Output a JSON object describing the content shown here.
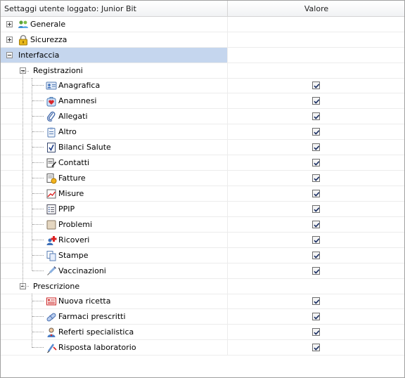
{
  "header": {
    "col_setting": "Settaggi utente loggato: Junior Bit",
    "col_value": "Valore"
  },
  "tree": {
    "generale": "Generale",
    "sicurezza": "Sicurezza",
    "interfaccia": "Interfaccia",
    "registrazioni": "Registrazioni",
    "prescrizione": "Prescrizione"
  },
  "registrazioni_items": [
    {
      "label": "Anagrafica",
      "icon": "contact-card-icon",
      "checked": true
    },
    {
      "label": "Anamnesi",
      "icon": "heart-bag-icon",
      "checked": true
    },
    {
      "label": "Allegati",
      "icon": "paperclip-icon",
      "checked": true
    },
    {
      "label": "Altro",
      "icon": "clipboard-list-icon",
      "checked": true
    },
    {
      "label": "Bilanci Salute",
      "icon": "check-document-icon",
      "checked": true
    },
    {
      "label": "Contatti",
      "icon": "note-pen-icon",
      "checked": true
    },
    {
      "label": "Fatture",
      "icon": "invoice-coin-icon",
      "checked": true
    },
    {
      "label": "Misure",
      "icon": "chart-measure-icon",
      "checked": true
    },
    {
      "label": "PPIP",
      "icon": "bullet-list-icon",
      "checked": true
    },
    {
      "label": "Problemi",
      "icon": "blank-square-icon",
      "checked": true
    },
    {
      "label": "Ricoveri",
      "icon": "patient-cross-icon",
      "checked": true
    },
    {
      "label": "Stampe",
      "icon": "copy-pages-icon",
      "checked": true
    },
    {
      "label": "Vaccinazioni",
      "icon": "syringe-icon",
      "checked": true
    }
  ],
  "prescrizione_items": [
    {
      "label": "Nuova ricetta",
      "icon": "prescription-icon",
      "checked": true
    },
    {
      "label": "Farmaci prescritti",
      "icon": "pill-icon",
      "checked": true
    },
    {
      "label": "Referti specialistica",
      "icon": "doctor-icon",
      "checked": true
    },
    {
      "label": "Risposta laboratorio",
      "icon": "lab-test-icon",
      "checked": true
    }
  ]
}
